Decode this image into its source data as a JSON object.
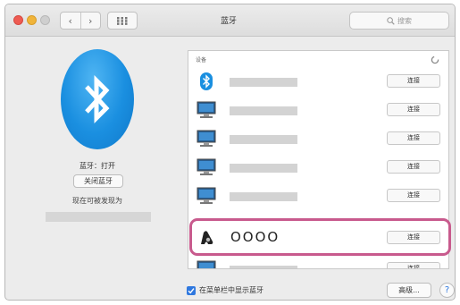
{
  "window": {
    "title": "蓝牙"
  },
  "toolbar": {
    "back_icon": "chevron-left-icon",
    "forward_icon": "chevron-right-icon",
    "back_glyph": "‹",
    "forward_glyph": "›",
    "show_all_icon": "grid-icon",
    "search_placeholder": "搜索"
  },
  "bluetooth": {
    "status": "蓝牙：打开",
    "toggle_label": "关闭蓝牙",
    "discoverable_text": "现在可被发现为",
    "accent": "#1a8fe0"
  },
  "devices": {
    "header": "设备",
    "connect_label": "连接",
    "items": [
      {
        "icon": "bluetooth-icon"
      },
      {
        "icon": "computer-icon"
      },
      {
        "icon": "computer-icon"
      },
      {
        "icon": "computer-icon"
      },
      {
        "icon": "computer-icon"
      },
      {
        "icon": "headphones-icon",
        "name": "OOOO"
      },
      {
        "icon": "computer-icon"
      }
    ]
  },
  "footer": {
    "menubar_checkbox_label": "在菜单栏中显示蓝牙",
    "checked": true,
    "advanced_label": "高级...",
    "help_label": "?"
  },
  "highlight_color": "#c85a8d"
}
